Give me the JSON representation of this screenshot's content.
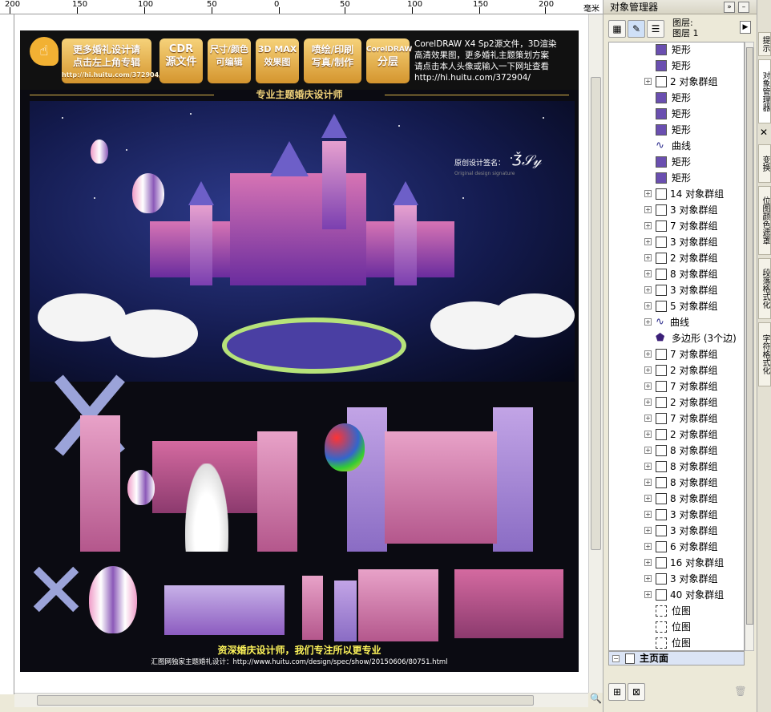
{
  "ruler": {
    "labels": [
      "200",
      "150",
      "100",
      "50",
      "0",
      "50",
      "100",
      "150",
      "200"
    ],
    "unit": "毫米"
  },
  "poster": {
    "top_buttons": [
      {
        "line1": "更多婚礼设计请",
        "line2": "点击左上角专辑",
        "url": "http://hi.huitu.com/372904/"
      },
      {
        "line1": "CDR",
        "line2": "源文件"
      },
      {
        "line1": "尺寸/颜色",
        "line2": "可编辑"
      },
      {
        "line1": "3D MAX",
        "line2": "效果图"
      },
      {
        "line1": "喷绘/印刷",
        "line2": "写真/制作"
      },
      {
        "line1": "CorelDRAW",
        "line2": "分层"
      }
    ],
    "top_note_line1": "CorelDRAW X4 Sp2源文件，3D渲染",
    "top_note_line2": "高清效果图，更多婚礼主题策划方案",
    "top_note_line3": "请点击本人头像或输入一下网址查看",
    "top_note_url": "http://hi.huitu.com/372904/",
    "subtitle": "专业主题婚庆设计师",
    "signature_label": "原创设计签名：",
    "signature_sub": "Original design signature",
    "signature_name": "Ǯ𝒮𝓎",
    "bottom_slogan": "资深婚庆设计师，我们专注所以更专业",
    "bottom_url": "汇图网独家主题婚礼设计：http://www.huitu.com/design/spec/show/20150606/80751.html"
  },
  "panel": {
    "title": "对象管理器",
    "layer_label_1": "图层:",
    "layer_label_2": "图层 1",
    "master_page": "主页面",
    "tree": [
      {
        "type": "rect",
        "label": "矩形",
        "expandable": false
      },
      {
        "type": "rect",
        "label": "矩形",
        "expandable": false
      },
      {
        "type": "group",
        "label": "2 对象群组",
        "expandable": true
      },
      {
        "type": "rect",
        "label": "矩形",
        "expandable": false
      },
      {
        "type": "rect",
        "label": "矩形",
        "expandable": false
      },
      {
        "type": "rect",
        "label": "矩形",
        "expandable": false
      },
      {
        "type": "curve",
        "label": "曲线",
        "expandable": false
      },
      {
        "type": "rect",
        "label": "矩形",
        "expandable": false
      },
      {
        "type": "rect",
        "label": "矩形",
        "expandable": false
      },
      {
        "type": "group",
        "label": "14 对象群组",
        "expandable": true
      },
      {
        "type": "group",
        "label": "3 对象群组",
        "expandable": true
      },
      {
        "type": "group",
        "label": "7 对象群组",
        "expandable": true
      },
      {
        "type": "group",
        "label": "3 对象群组",
        "expandable": true
      },
      {
        "type": "group",
        "label": "2 对象群组",
        "expandable": true
      },
      {
        "type": "group",
        "label": "8 对象群组",
        "expandable": true
      },
      {
        "type": "group",
        "label": "3 对象群组",
        "expandable": true
      },
      {
        "type": "group",
        "label": "5 对象群组",
        "expandable": true
      },
      {
        "type": "curve",
        "label": "曲线",
        "expandable": true
      },
      {
        "type": "poly",
        "label": "多边形 (3个边)",
        "expandable": false
      },
      {
        "type": "group",
        "label": "7 对象群组",
        "expandable": true
      },
      {
        "type": "group",
        "label": "2 对象群组",
        "expandable": true
      },
      {
        "type": "group",
        "label": "7 对象群组",
        "expandable": true
      },
      {
        "type": "group",
        "label": "2 对象群组",
        "expandable": true
      },
      {
        "type": "group",
        "label": "7 对象群组",
        "expandable": true
      },
      {
        "type": "group",
        "label": "2 对象群组",
        "expandable": true
      },
      {
        "type": "group",
        "label": "8 对象群组",
        "expandable": true
      },
      {
        "type": "group",
        "label": "8 对象群组",
        "expandable": true
      },
      {
        "type": "group",
        "label": "8 对象群组",
        "expandable": true
      },
      {
        "type": "group",
        "label": "8 对象群组",
        "expandable": true
      },
      {
        "type": "group",
        "label": "3 对象群组",
        "expandable": true
      },
      {
        "type": "group",
        "label": "3 对象群组",
        "expandable": true
      },
      {
        "type": "group",
        "label": "6 对象群组",
        "expandable": true
      },
      {
        "type": "group",
        "label": "16 对象群组",
        "expandable": true
      },
      {
        "type": "group",
        "label": "3 对象群组",
        "expandable": true
      },
      {
        "type": "group",
        "label": "40 对象群组",
        "expandable": true
      },
      {
        "type": "bitmap",
        "label": "位图",
        "expandable": false
      },
      {
        "type": "bitmap",
        "label": "位图",
        "expandable": false
      },
      {
        "type": "bitmap",
        "label": "位图",
        "expandable": false
      }
    ]
  },
  "side_tabs": [
    "提示",
    "对象管理器",
    "变换",
    "位图颜色遮罩",
    "段落格式化",
    "字符格式化"
  ],
  "colors": {
    "accent_gold": "#d4952e",
    "object_rect": "#6a4fb0",
    "panel_bg": "#ece9d8",
    "poster_bg": "#0b0b12"
  }
}
